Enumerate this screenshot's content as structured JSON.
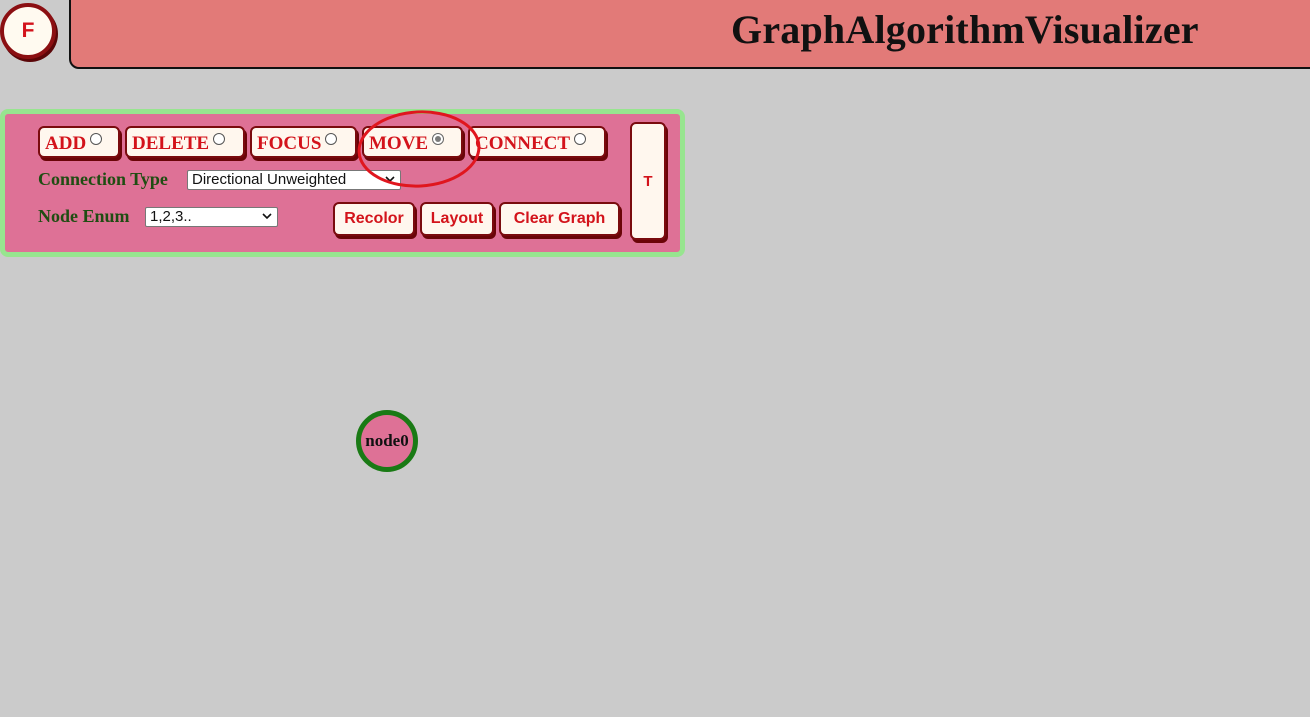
{
  "app": {
    "title": "GraphAlgorithmVisualizer",
    "fab_label": "F"
  },
  "modes": [
    {
      "label": "ADD",
      "checked": false
    },
    {
      "label": "DELETE",
      "checked": false
    },
    {
      "label": "FOCUS",
      "checked": false
    },
    {
      "label": "MOVE",
      "checked": true
    },
    {
      "label": "CONNECT",
      "checked": false
    }
  ],
  "connection_type": {
    "label": "Connection Type",
    "selected": "Directional Unweighted"
  },
  "node_enum": {
    "label": "Node Enum",
    "selected": "1,2,3.."
  },
  "actions": {
    "recolor": "Recolor",
    "layout": "Layout",
    "clear_graph": "Clear Graph"
  },
  "toggle_label": "T",
  "graph": {
    "nodes": [
      {
        "label": "node0"
      }
    ]
  },
  "colors": {
    "header_bg": "#e27a78",
    "panel_bg": "#de7196",
    "panel_border": "#97e58f",
    "button_text": "#d3131b",
    "node_border": "#1a7a15",
    "annotation": "#e0161e"
  }
}
